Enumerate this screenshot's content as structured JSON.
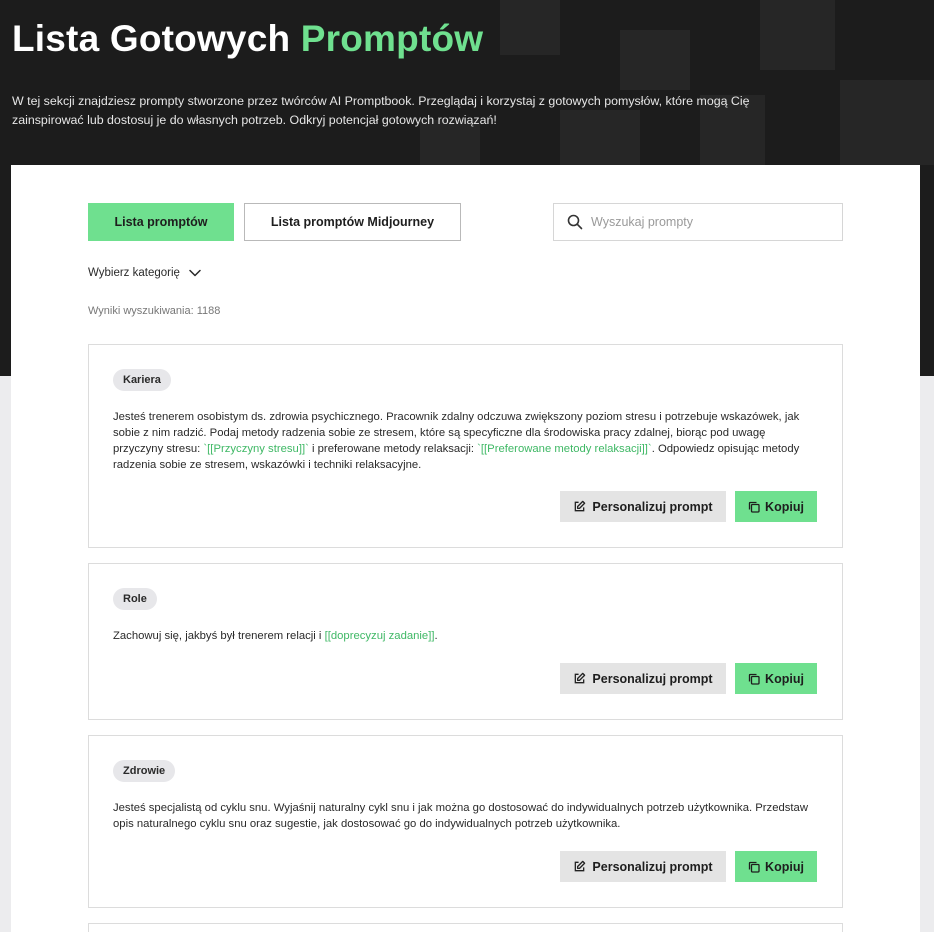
{
  "hero": {
    "title_main": "Lista Gotowych",
    "title_accent": "Promptów",
    "description": "W tej sekcji znajdziesz prompty stworzone przez twórców AI Promptbook. Przeglądaj i korzystaj z gotowych pomysłów, które mogą Cię zainspirować lub dostosuj je do własnych potrzeb. Odkryj potencjał gotowych rozwiązań!"
  },
  "tabs": [
    {
      "label": "Lista promptów",
      "active": true
    },
    {
      "label": "Lista promptów Midjourney",
      "active": false
    }
  ],
  "search": {
    "placeholder": "Wyszukaj prompty",
    "value": ""
  },
  "filter": {
    "category_label": "Wybierz kategorię"
  },
  "results": {
    "text": "Wyniki wyszukiwania: 1188"
  },
  "cards": [
    {
      "category": "Kariera",
      "text_parts": [
        "Jesteś trenerem osobistym ds. zdrowia psychicznego. Pracownik zdalny odczuwa zwiększony poziom stresu i potrzebuje wskazówek, jak sobie z nim radzić. Podaj metody radzenia sobie ze stresem, które są specyficzne dla środowiska pracy zdalnej, biorąc pod uwagę przyczyny stresu: ",
        "`[[Przyczyny stresu]]`",
        " i preferowane metody relaksacji: ",
        "`[[Preferowane metody relaksacji]]`",
        ". Odpowiedz opisując metody radzenia sobie ze stresem, wskazówki i techniki relaksacyjne."
      ],
      "personalize_label": "Personalizuj prompt",
      "copy_label": "Kopiuj"
    },
    {
      "category": "Role",
      "text_parts": [
        "Zachowuj się, jakbyś był trenerem relacji i ",
        "[[doprecyzuj zadanie]]",
        "."
      ],
      "personalize_label": "Personalizuj prompt",
      "copy_label": "Kopiuj"
    },
    {
      "category": "Zdrowie",
      "text_parts": [
        "Jesteś specjalistą od cyklu snu. Wyjaśnij naturalny cykl snu i jak można go dostosować do indywidualnych potrzeb użytkownika. Przedstaw opis naturalnego cyklu snu oraz sugestie, jak dostosować go do indywidualnych potrzeb użytkownika."
      ],
      "personalize_label": "Personalizuj prompt",
      "copy_label": "Kopiuj"
    }
  ],
  "colors": {
    "accent": "#6fe08f",
    "hero_bg": "#1c1c1c",
    "highlight_text": "#3fb865",
    "page_bg": "#ececee"
  }
}
